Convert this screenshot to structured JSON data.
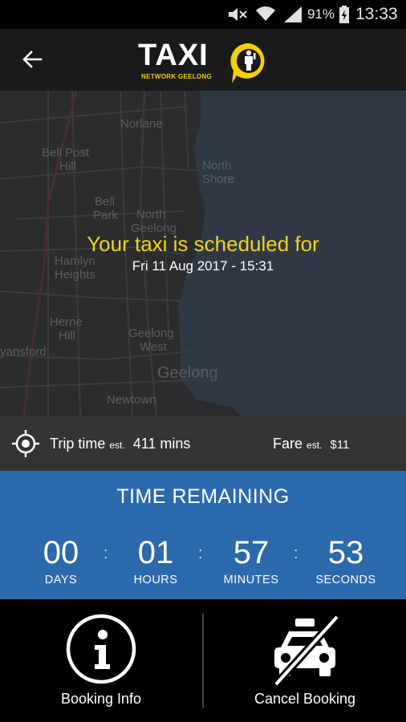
{
  "status_bar": {
    "battery_percent": "91%",
    "clock": "13:33",
    "icons": [
      "mute-icon",
      "wifi-icon",
      "signal-icon",
      "battery-icon"
    ]
  },
  "header": {
    "back_icon": "arrow-left-icon",
    "logo_text": "TAXI",
    "logo_subtitle": "NETWORK GEELONG"
  },
  "map": {
    "labels": [
      {
        "text": "Norlane"
      },
      {
        "text": "Bell Post"
      },
      {
        "text": "Hill"
      },
      {
        "text": "North"
      },
      {
        "text": "Shore"
      },
      {
        "text": "Bell"
      },
      {
        "text": "Park"
      },
      {
        "text": "North"
      },
      {
        "text": "Geelong"
      },
      {
        "text": "Hamlyn"
      },
      {
        "text": "Heights"
      },
      {
        "text": "Herne"
      },
      {
        "text": "Hill"
      },
      {
        "text": "Geelong"
      },
      {
        "text": "West"
      },
      {
        "text": "yansford"
      },
      {
        "text": "Geelong"
      },
      {
        "text": "Newtown"
      }
    ],
    "scheduled_title": "Your taxi is scheduled for",
    "scheduled_datetime": "Fri 11 Aug 2017 - 15:31"
  },
  "trip": {
    "trip_label": "Trip time",
    "trip_est": "est.",
    "trip_value": "411 mins",
    "fare_label": "Fare",
    "fare_est": "est.",
    "fare_value": "$11"
  },
  "countdown": {
    "title": "TIME REMAINING",
    "units": [
      {
        "value": "00",
        "label": "DAYS"
      },
      {
        "value": "01",
        "label": "HOURS"
      },
      {
        "value": "57",
        "label": "MINUTES"
      },
      {
        "value": "53",
        "label": "SECONDS"
      }
    ],
    "separator": ":"
  },
  "actions": {
    "booking_info_label": "Booking Info",
    "cancel_booking_label": "Cancel Booking"
  },
  "colors": {
    "accent_yellow": "#f3d21b",
    "countdown_blue": "#2c6aae",
    "header_bg": "#1a1a1a"
  }
}
